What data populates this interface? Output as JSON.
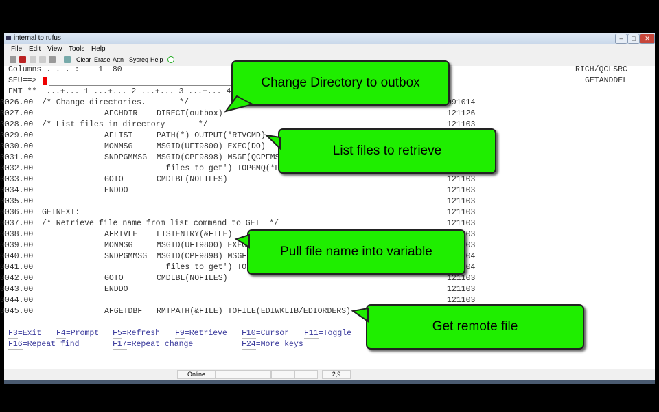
{
  "window": {
    "title": "internal to rufus",
    "controls": [
      "–",
      "□",
      "✕"
    ]
  },
  "menu": [
    "File",
    "Edit",
    "View",
    "Tools",
    "Help"
  ],
  "toolbar": {
    "buttons": [
      "Clear",
      "Erase",
      "Attn",
      "Sysreq",
      "Help"
    ]
  },
  "header": {
    "columns_label": "Columns . . . :    1  80",
    "member_lib": "RICH/QCLSRC",
    "member_name": "GETANDDEL",
    "prompt": "SEU==>",
    "ruler": "FMT **  ...+... 1 ...+... 2 ...+... 3 ...+... 4"
  },
  "lines": [
    {
      "seq": "0026.00",
      "text": "/* Change directories.       */",
      "date": "091014"
    },
    {
      "seq": "0027.00",
      "cmd": "AFCHDIR",
      "params": "DIRECT(outbox)",
      "date": "121126"
    },
    {
      "seq": "0028.00",
      "text": "/* List files in directory       */",
      "date": "121103"
    },
    {
      "seq": "0029.00",
      "cmd": "AFLIST",
      "params": "PATH(*) OUTPUT(*RTVCMD)",
      "date": "121103"
    },
    {
      "seq": "0030.00",
      "cmd": "MONMSG",
      "params": "MSGID(UFT9800) EXEC(DO)",
      "date": "121103"
    },
    {
      "seq": "0031.00",
      "cmd": "SNDPGMMSG",
      "params": "MSGID(CPF9898) MSGF(QCPFMSG",
      "date": "121103"
    },
    {
      "seq": "0032.00",
      "params": "  files to get') TOPGMQ(*P",
      "date": "121103"
    },
    {
      "seq": "0033.00",
      "cmd": "GOTO",
      "params": "CMDLBL(NOFILES)",
      "date": "121103"
    },
    {
      "seq": "0034.00",
      "cmd": "ENDDO",
      "date": "121103"
    },
    {
      "seq": "0035.00",
      "date": "121103"
    },
    {
      "seq": "0036.00",
      "text": "GETNEXT:",
      "date": "121103"
    },
    {
      "seq": "0037.00",
      "text": "/* Retrieve file name from list command to GET  */",
      "date": "121103"
    },
    {
      "seq": "0038.00",
      "cmd": "AFRTVLE",
      "params": "LISTENTRY(&FILE)",
      "date": "121103"
    },
    {
      "seq": "0039.00",
      "cmd": "MONMSG",
      "params": "MSGID(UFT9800) EXEC",
      "date": "121103"
    },
    {
      "seq": "0040.00",
      "cmd": "SNDPGMMSG",
      "params": "MSGID(CPF9898) MSGF",
      "date": "121104"
    },
    {
      "seq": "0041.00",
      "params": "  files to get') TO",
      "date": "121104"
    },
    {
      "seq": "0042.00",
      "cmd": "GOTO",
      "params": "CMDLBL(NOFILES)",
      "date": "121103"
    },
    {
      "seq": "0043.00",
      "cmd": "ENDDO",
      "date": "121103"
    },
    {
      "seq": "0044.00",
      "date": "121103"
    },
    {
      "seq": "0045.00",
      "cmd": "AFGETDBF",
      "params": "RMTPATH(&FILE) TOFILE(EDIWKLIB/EDIORDERS)"
    }
  ],
  "fkeys": [
    {
      "key": "F3",
      "label": "=Exit"
    },
    {
      "key": "F4",
      "label": "=Prompt"
    },
    {
      "key": "F5",
      "label": "=Refresh"
    },
    {
      "key": "F9",
      "label": "=Retrieve"
    },
    {
      "key": "F10",
      "label": "=Cursor"
    },
    {
      "key": "F11",
      "label": "=Toggle"
    },
    {
      "key": "F16",
      "label": "=Repeat find"
    },
    {
      "key": "F17",
      "label": "=Repeat change"
    },
    {
      "key": "F24",
      "label": "=More keys"
    }
  ],
  "status": {
    "connection": "Online",
    "cursor_pos": "2,9"
  },
  "callouts": [
    "Change Directory to outbox",
    "List files to retrieve",
    "Pull file name into variable",
    "Get remote file"
  ],
  "colors": {
    "callout": "#1fee00",
    "cursor": "#ee0000",
    "fkey": "#3a3a9c"
  }
}
